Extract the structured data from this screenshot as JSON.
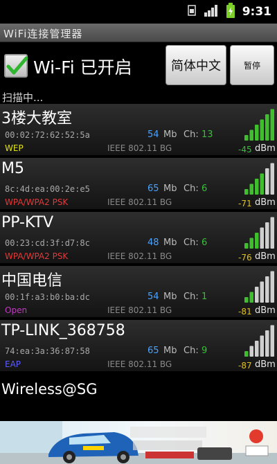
{
  "status_bar": {
    "time": "9:31",
    "icons": [
      "sim-card-icon",
      "signal-strength-icon",
      "battery-charging-icon"
    ]
  },
  "app": {
    "title": "WiFi连接管理器"
  },
  "controls": {
    "wifi_toggle": {
      "label": "Wi-Fi 已开启",
      "checked": true
    },
    "language_button": "简体中文",
    "pause_button": "暂停"
  },
  "scan_status": "扫描中...",
  "networks": [
    {
      "ssid": "3楼大教室",
      "bssid": "00:02:72:62:52:5a",
      "rate": "54",
      "rate_unit": "Mb",
      "channel_label": "Ch:",
      "channel": "13",
      "channel_color": "#36c236",
      "security": "WEP",
      "security_color": "#e2e21a",
      "standard": "IEEE 802.11 BG",
      "signal": "-45",
      "signal_unit": "dBm",
      "signal_color": "#36c236",
      "signal_bars": 6
    },
    {
      "ssid": "M5",
      "bssid": "8c:4d:ea:00:2e:e5",
      "rate": "65",
      "rate_unit": "Mb",
      "channel_label": "Ch:",
      "channel": "6",
      "channel_color": "#36c236",
      "security": "WPA/WPA2 PSK",
      "security_color": "#e03a3a",
      "standard": "IEEE 802.11 BG",
      "signal": "-71",
      "signal_unit": "dBm",
      "signal_color": "#e2c21a",
      "signal_bars": 4
    },
    {
      "ssid": "PP-KTV",
      "bssid": "00:23:cd:3f:d7:8c",
      "rate": "48",
      "rate_unit": "Mb",
      "channel_label": "Ch:",
      "channel": "6",
      "channel_color": "#36c236",
      "security": "WPA/WPA2 PSK",
      "security_color": "#e03a3a",
      "standard": "IEEE 802.11 BG",
      "signal": "-76",
      "signal_unit": "dBm",
      "signal_color": "#e2c21a",
      "signal_bars": 3
    },
    {
      "ssid": "中国电信",
      "bssid": "00:1f:a3:b0:ba:dc",
      "rate": "54",
      "rate_unit": "Mb",
      "channel_label": "Ch:",
      "channel": "1",
      "channel_color": "#36c236",
      "security": "Open",
      "security_color": "#c338c3",
      "standard": "IEEE 802.11 BG",
      "signal": "-81",
      "signal_unit": "dBm",
      "signal_color": "#e2c21a",
      "signal_bars": 2
    },
    {
      "ssid": "TP-LINK_368758",
      "bssid": "74:ea:3a:36:87:58",
      "rate": "65",
      "rate_unit": "Mb",
      "channel_label": "Ch:",
      "channel": "9",
      "channel_color": "#36c236",
      "security": "EAP",
      "security_color": "#5b5bff",
      "standard": "IEEE 802.11 BG",
      "signal": "-87",
      "signal_unit": "dBm",
      "signal_color": "#e2c21a",
      "signal_bars": 1
    }
  ],
  "partial_network": {
    "ssid": "Wireless@SG"
  },
  "ad_banner": {
    "icons": [
      "race-car-icon",
      "brand-logo-icon"
    ]
  }
}
